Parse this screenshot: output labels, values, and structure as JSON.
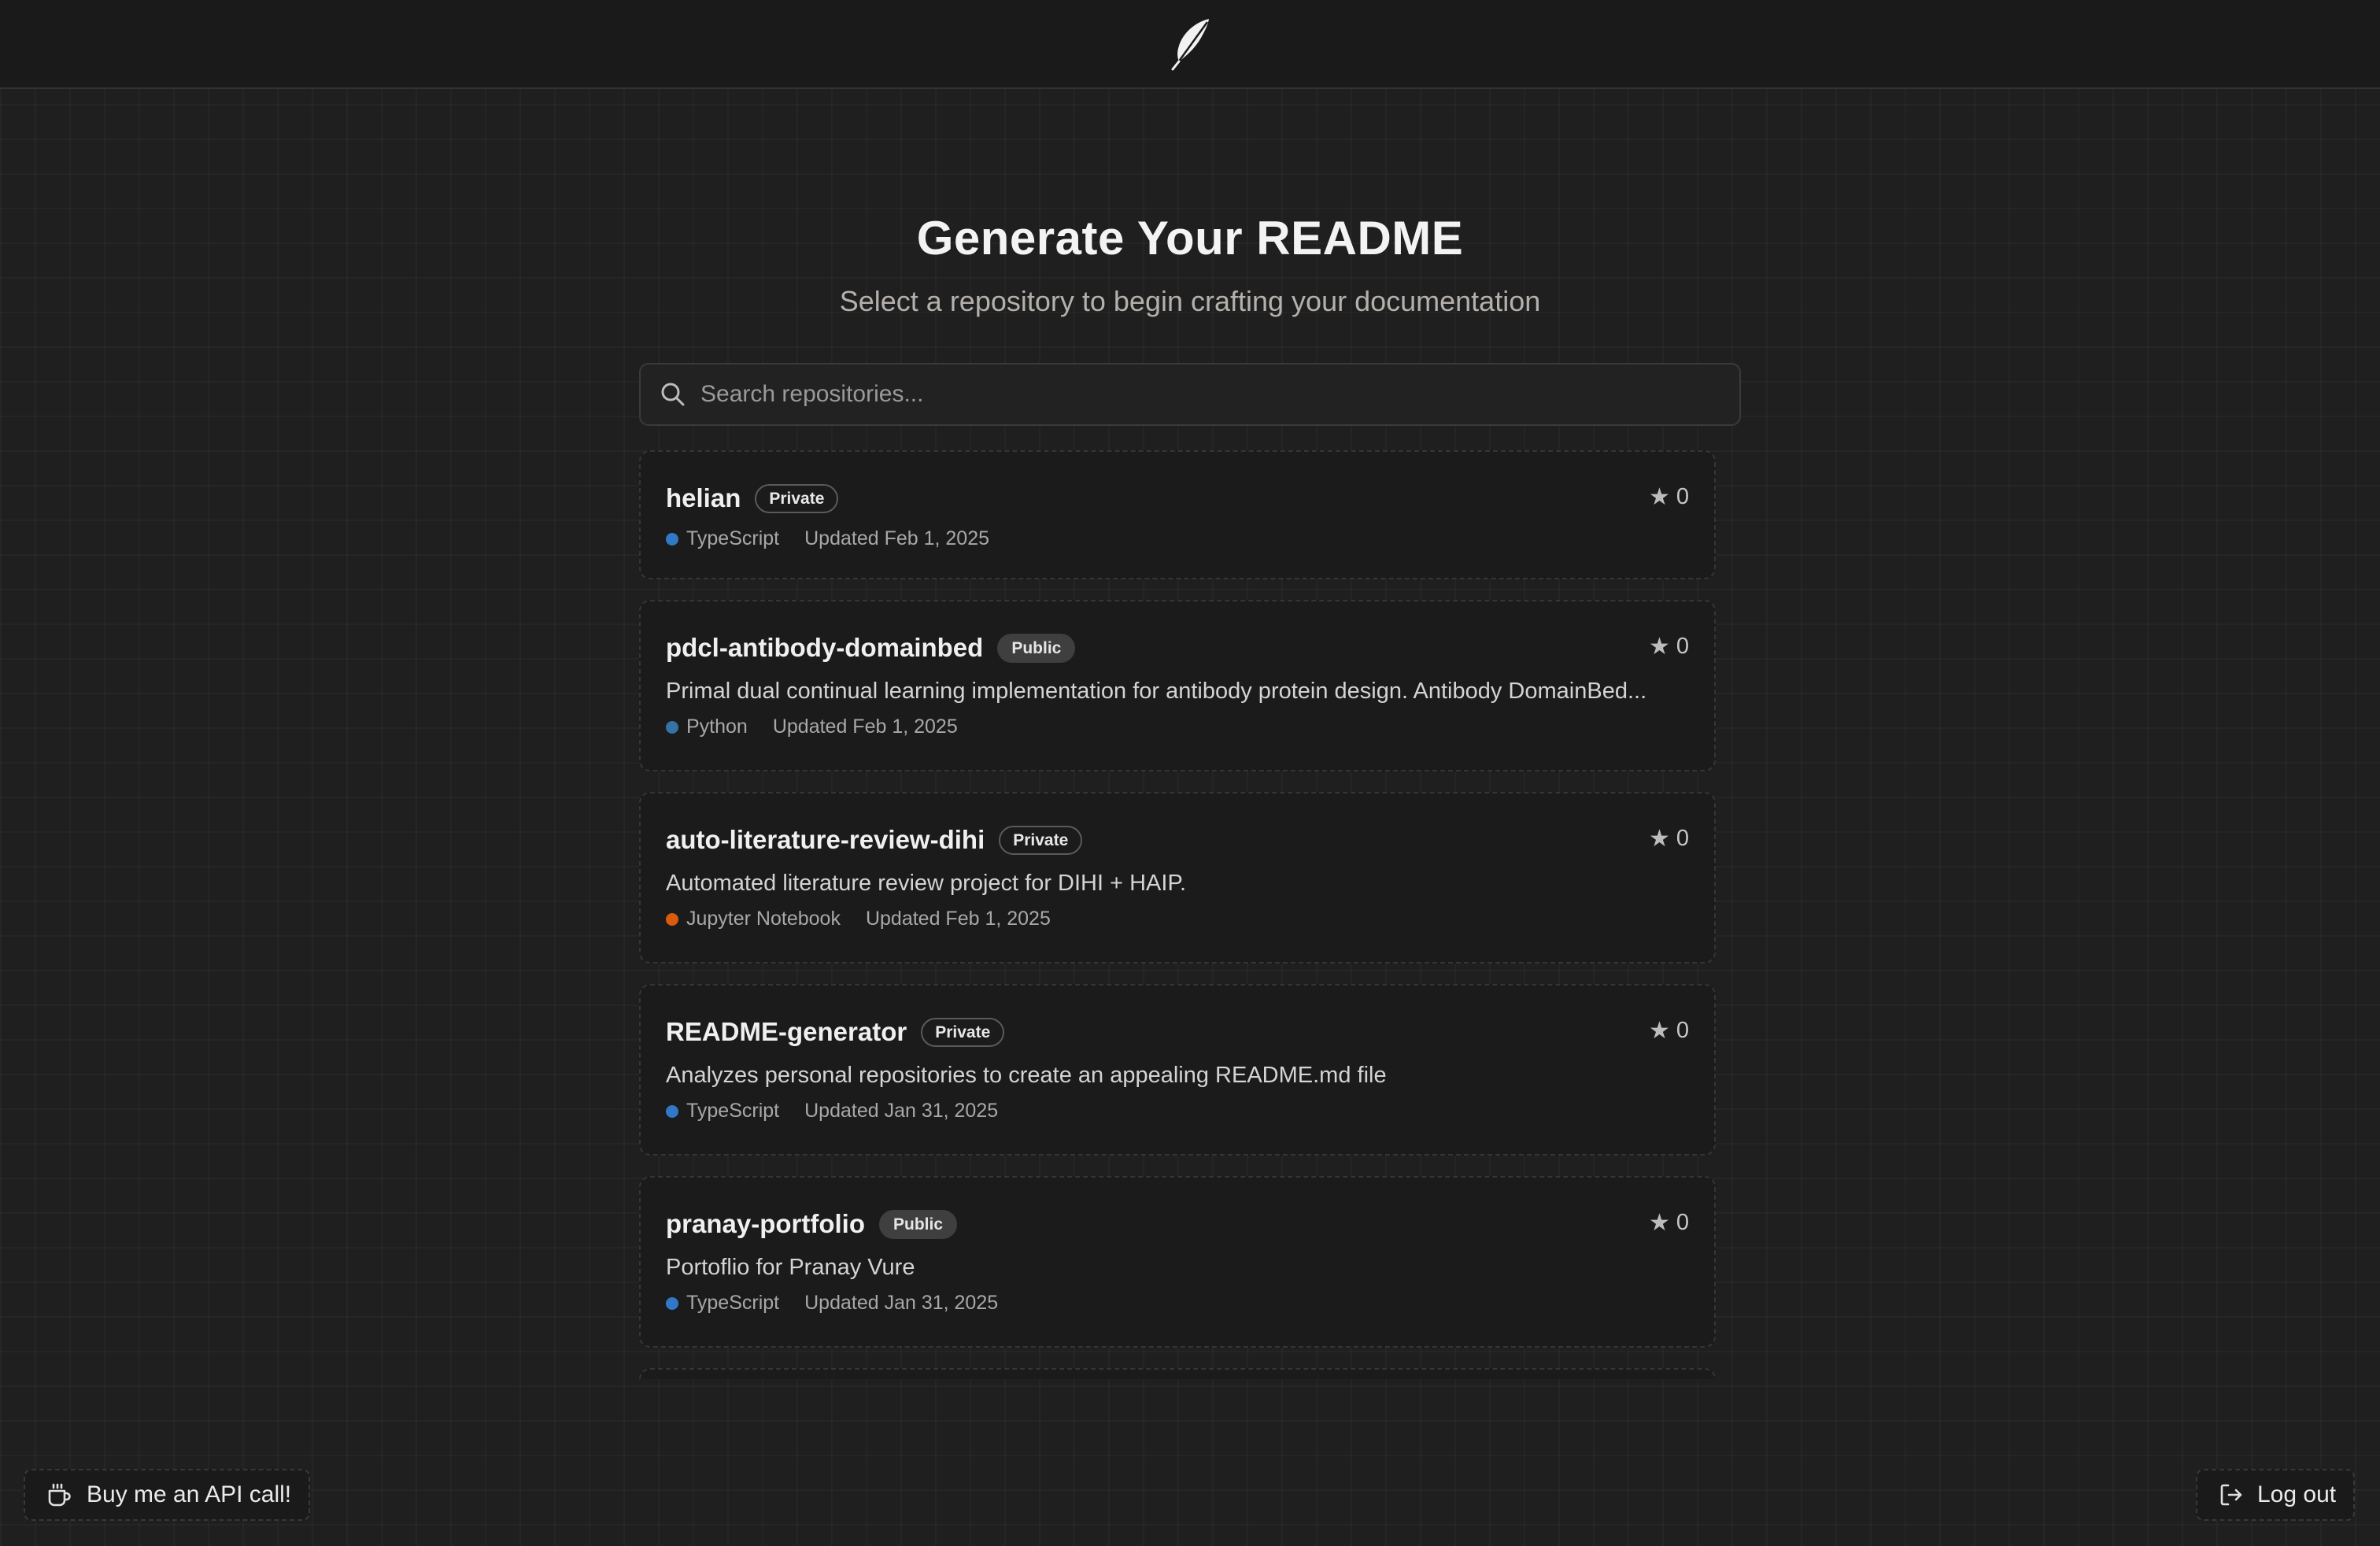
{
  "header": {
    "logo_icon": "feather-icon"
  },
  "hero": {
    "title": "Generate Your README",
    "subtitle": "Select a repository to begin crafting your documentation"
  },
  "search": {
    "placeholder": "Search repositories...",
    "value": "",
    "icon": "search-icon"
  },
  "repos": [
    {
      "name": "helian",
      "visibility": "Private",
      "stars": "0",
      "description": "",
      "language": "TypeScript",
      "lang_color": "#3178c6",
      "updated": "Updated Feb 1, 2025"
    },
    {
      "name": "pdcl-antibody-domainbed",
      "visibility": "Public",
      "stars": "0",
      "description": "Primal dual continual learning implementation for antibody protein design. Antibody DomainBed...",
      "language": "Python",
      "lang_color": "#3572a5",
      "updated": "Updated Feb 1, 2025"
    },
    {
      "name": "auto-literature-review-dihi",
      "visibility": "Private",
      "stars": "0",
      "description": "Automated literature review project for DIHI + HAIP.",
      "language": "Jupyter Notebook",
      "lang_color": "#da5b0b",
      "updated": "Updated Feb 1, 2025"
    },
    {
      "name": "README-generator",
      "visibility": "Private",
      "stars": "0",
      "description": "Analyzes personal repositories to create an appealing README.md file",
      "language": "TypeScript",
      "lang_color": "#3178c6",
      "updated": "Updated Jan 31, 2025"
    },
    {
      "name": "pranay-portfolio",
      "visibility": "Public",
      "stars": "0",
      "description": "Portoflio for Pranay Vure",
      "language": "TypeScript",
      "lang_color": "#3178c6",
      "updated": "Updated Jan 31, 2025"
    }
  ],
  "footer": {
    "buy_label": "Buy me an API call!",
    "buy_icon": "coffee-cup-icon",
    "logout_label": "Log out",
    "logout_icon": "logout-icon"
  }
}
